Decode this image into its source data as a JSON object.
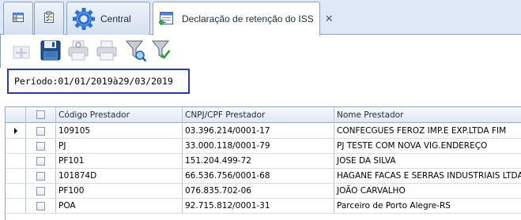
{
  "tabs": [
    {
      "id": "tab-grid-view",
      "label": "",
      "icon": "grid-table-icon"
    },
    {
      "id": "tab-checklist",
      "label": "",
      "icon": "checklist-clipboard-icon"
    },
    {
      "id": "tab-central",
      "label": "Central",
      "icon": "gear-icon"
    },
    {
      "id": "tab-declaracao",
      "label": "Declaração de retenção do ISS",
      "icon": "document-add-icon",
      "active": true,
      "close": "✕"
    }
  ],
  "toolbar": {
    "buttons": [
      {
        "name": "add-button",
        "icon": "add-record-icon",
        "enabled": false
      },
      {
        "name": "save-button",
        "icon": "floppy-disk-icon",
        "enabled": true
      },
      {
        "name": "print-preview-button",
        "icon": "printer-search-icon",
        "enabled": false
      },
      {
        "name": "print-button",
        "icon": "printer-icon",
        "enabled": false
      },
      {
        "name": "filter-button",
        "icon": "funnel-search-icon",
        "enabled": true
      },
      {
        "name": "filter-apply-button",
        "icon": "funnel-check-icon",
        "enabled": true
      }
    ]
  },
  "period": {
    "label": "Período:",
    "start": "01/01/2019",
    "separator": "à",
    "end": "29/03/2019"
  },
  "grid": {
    "columns": [
      "",
      "Código Prestador",
      "CNPJ/CPF Prestador",
      "Nome Prestador"
    ],
    "rows": [
      {
        "codigo": "109105",
        "cnpj": "03.396.214/0001-17",
        "nome": "CONFECGUES FEROZ IMP.E EXP.LTDA FIM",
        "current": true
      },
      {
        "codigo": "PJ",
        "cnpj": "33.000.118/0001-79",
        "nome": "PJ TESTE COM NOVA VIG.ENDEREÇO"
      },
      {
        "codigo": "PF101",
        "cnpj": "151.204.499-72",
        "nome": "JOSE DA SILVA"
      },
      {
        "codigo": "101874D",
        "cnpj": "66.536.756/0001-68",
        "nome": "HAGANE FACAS E SERRAS INDUSTRIAIS LTDA."
      },
      {
        "codigo": "PF100",
        "cnpj": "076.835.702-06",
        "nome": "JOÃO CARVALHO"
      },
      {
        "codigo": "POA",
        "cnpj": "92.715.812/0001-31",
        "nome": "Parceiro de Porto Alegre-RS"
      }
    ]
  }
}
